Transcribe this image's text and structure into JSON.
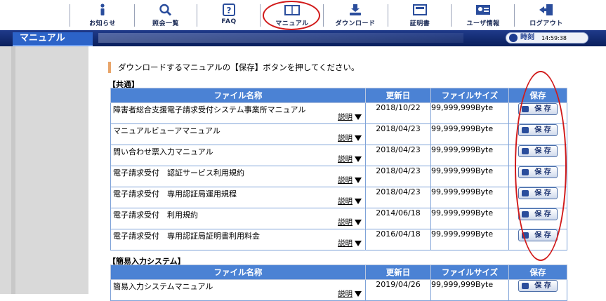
{
  "toolbar": {
    "items": [
      {
        "label": "お知らせ",
        "icon": "info-icon"
      },
      {
        "label": "照会一覧",
        "icon": "search-icon"
      },
      {
        "label": "FAQ",
        "icon": "faq-icon"
      },
      {
        "label": "マニュアル",
        "icon": "book-icon"
      },
      {
        "label": "ダウンロード",
        "icon": "download-icon"
      },
      {
        "label": "証明書",
        "icon": "certificate-icon"
      },
      {
        "label": "ユーザ情報",
        "icon": "user-card-icon"
      },
      {
        "label": "ログアウト",
        "icon": "logout-icon"
      }
    ]
  },
  "header": {
    "title": "マニュアル",
    "clock_label": "時刻",
    "clock_time": "14:59:38"
  },
  "instruction": "ダウンロードするマニュアルの【保存】ボタンを押してください。",
  "columns": {
    "name": "ファイル名称",
    "date": "更新日",
    "size": "ファイルサイズ",
    "save": "保存"
  },
  "sections": [
    {
      "label": "【共通】",
      "rows": [
        {
          "name": "障害者総合支援電子請求受付システム事業所マニュアル",
          "explain": "説明",
          "date": "2018/10/22",
          "size": "99,999,999Byte",
          "save": "保 存"
        },
        {
          "name": "マニュアルビューアマニュアル",
          "explain": "説明",
          "date": "2018/04/23",
          "size": "99,999,999Byte",
          "save": "保 存"
        },
        {
          "name": "問い合わせ票入力マニュアル",
          "explain": "説明",
          "date": "2018/04/23",
          "size": "99,999,999Byte",
          "save": "保 存"
        },
        {
          "name": "電子請求受付　認証サービス利用規約",
          "explain": "説明",
          "date": "2018/04/23",
          "size": "99,999,999Byte",
          "save": "保 存"
        },
        {
          "name": "電子請求受付　専用認証局運用規程",
          "explain": "説明",
          "date": "2018/04/23",
          "size": "99,999,999Byte",
          "save": "保 存"
        },
        {
          "name": "電子請求受付　利用規約",
          "explain": "説明",
          "date": "2014/06/18",
          "size": "99,999,999Byte",
          "save": "保 存"
        },
        {
          "name": "電子請求受付　専用認証局証明書利用料金",
          "explain": "説明",
          "date": "2016/04/18",
          "size": "99,999,999Byte",
          "save": "保 存"
        }
      ]
    },
    {
      "label": "【簡易入力システム】",
      "rows": [
        {
          "name": "簡易入力システムマニュアル",
          "explain": "説明",
          "date": "2019/04/26",
          "size": "99,999,999Byte",
          "save": "保 存"
        }
      ]
    }
  ]
}
